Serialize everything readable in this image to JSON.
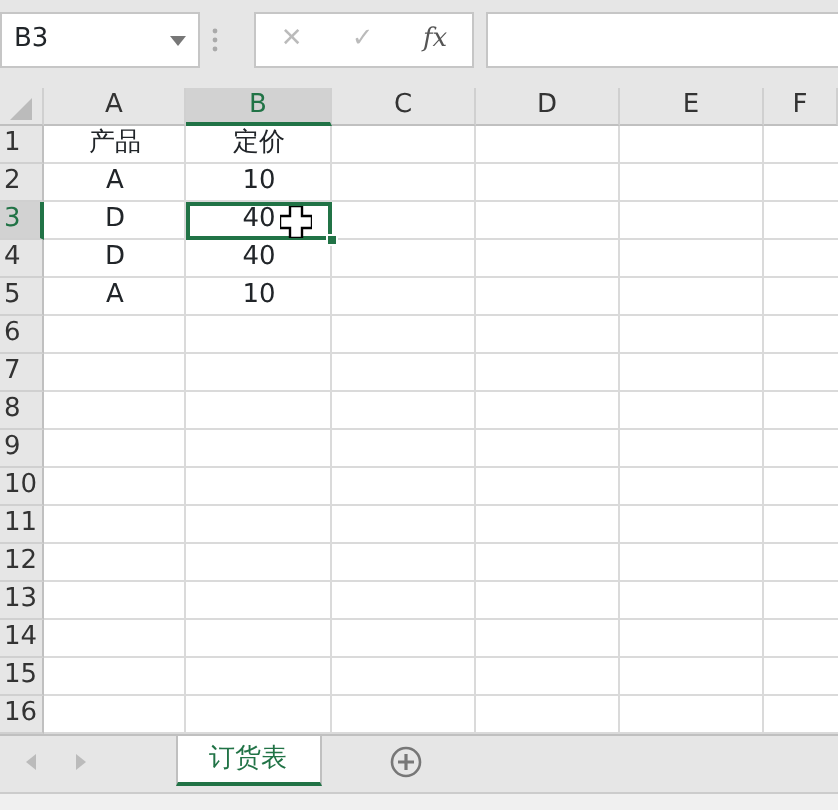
{
  "name_box": {
    "value": "B3"
  },
  "formula_bar": {
    "cancel": "✕",
    "enter": "✓",
    "function": "fx"
  },
  "columns": [
    {
      "label": "A",
      "selected": false
    },
    {
      "label": "B",
      "selected": true
    },
    {
      "label": "C",
      "selected": false
    },
    {
      "label": "D",
      "selected": false
    },
    {
      "label": "E",
      "selected": false
    },
    {
      "label": "F",
      "selected": false
    }
  ],
  "rows": [
    {
      "label": "1",
      "selected": false,
      "cells": [
        "产品",
        "定价"
      ]
    },
    {
      "label": "2",
      "selected": false,
      "cells": [
        "A",
        "10"
      ]
    },
    {
      "label": "3",
      "selected": true,
      "cells": [
        "D",
        "40"
      ]
    },
    {
      "label": "4",
      "selected": false,
      "cells": [
        "D",
        "40"
      ]
    },
    {
      "label": "5",
      "selected": false,
      "cells": [
        "A",
        "10"
      ]
    },
    {
      "label": "6",
      "selected": false,
      "cells": []
    },
    {
      "label": "7",
      "selected": false,
      "cells": []
    },
    {
      "label": "8",
      "selected": false,
      "cells": []
    },
    {
      "label": "9",
      "selected": false,
      "cells": []
    },
    {
      "label": "10",
      "selected": false,
      "cells": []
    },
    {
      "label": "11",
      "selected": false,
      "cells": []
    },
    {
      "label": "12",
      "selected": false,
      "cells": []
    },
    {
      "label": "13",
      "selected": false,
      "cells": []
    },
    {
      "label": "14",
      "selected": false,
      "cells": []
    },
    {
      "label": "15",
      "selected": false,
      "cells": []
    },
    {
      "label": "16",
      "selected": false,
      "cells": []
    }
  ],
  "sheet_tabs": [
    {
      "label": "订货表",
      "selected": true
    }
  ]
}
